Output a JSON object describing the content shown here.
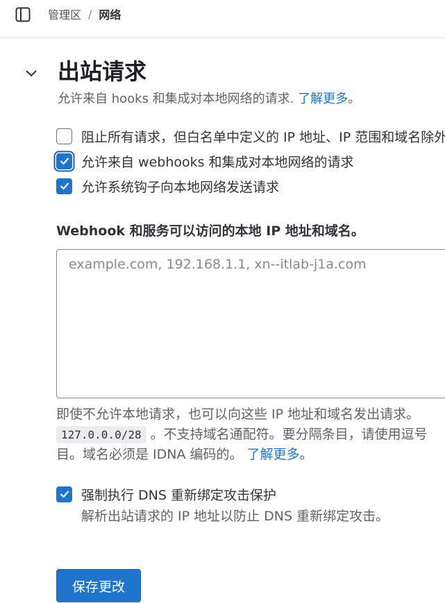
{
  "breadcrumb": {
    "parent": "管理区",
    "separator": "/",
    "current": "网络"
  },
  "icons": {
    "sidebar_toggle": "sidebar-panel-icon",
    "section_toggle": "chevron-down-icon",
    "checkmark": "check-icon"
  },
  "section": {
    "title": "出站请求",
    "description": "允许来自 hooks 和集成对本地网络的请求. ",
    "description_link": "了解更多",
    "description_suffix": "。"
  },
  "options": [
    {
      "label": "阻止所有请求，但白名单中定义的 IP 地址、IP 范围和域名除外",
      "checked": false
    },
    {
      "label": "允许来自 webhooks 和集成对本地网络的请求",
      "checked": true,
      "focused": true
    },
    {
      "label": "允许系统钩子向本地网络发送请求",
      "checked": true
    }
  ],
  "allowlist": {
    "label": "Webhook 和服务可以访问的本地 IP 地址和域名。",
    "placeholder": "example.com, 192.168.1.1, xn--itlab-j1a.com",
    "value": ""
  },
  "help": {
    "line1": "即使不允许本地请求，也可以向这些 IP 地址和域名发出请求。",
    "code": "127.0.0.0/28",
    "line2_rest": " 。不支持域名通配符。要分隔条目，请使用逗号",
    "line3": "目。域名必须是 IDNA 编码的。 ",
    "link": "了解更多",
    "link_suffix": "。"
  },
  "dns": {
    "label": "强制执行 DNS 重新绑定攻击保护",
    "help": "解析出站请求的 IP 地址以防止 DNS 重新绑定攻击。",
    "checked": true
  },
  "save_button": "保存更改",
  "colors": {
    "accent": "#1f75cb",
    "text": "#333238",
    "muted": "#626168"
  }
}
